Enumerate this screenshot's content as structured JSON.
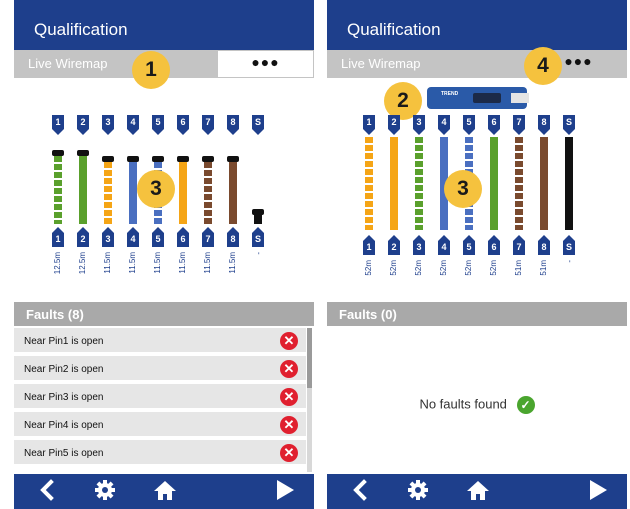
{
  "left": {
    "title": "Qualification",
    "tab_label": "Live Wiremap",
    "more_label": "●●●",
    "callouts": [
      "1",
      "3"
    ],
    "pins": [
      "1",
      "2",
      "3",
      "4",
      "5",
      "6",
      "7",
      "8",
      "S"
    ],
    "lengths": [
      "12.5m",
      "12.5m",
      "11.5m",
      "11.5m",
      "11.5m",
      "11.5m",
      "11.5m",
      "11.5m",
      "-"
    ],
    "faults_header": "Faults (8)",
    "faults": [
      "Near Pin1 is open",
      "Near Pin2 is open",
      "Near Pin3 is open",
      "Near Pin4 is open",
      "Near Pin5 is open"
    ],
    "fault_icon": "error-x-icon"
  },
  "right": {
    "title": "Qualification",
    "tab_label": "Live Wiremap",
    "more_label": "●●●",
    "callouts": [
      "2",
      "3",
      "4"
    ],
    "device_text": "TREND",
    "pins": [
      "1",
      "2",
      "3",
      "4",
      "5",
      "6",
      "7",
      "8",
      "S"
    ],
    "lengths": [
      "52m",
      "52m",
      "52m",
      "52m",
      "52m",
      "52m",
      "51m",
      "51m",
      "-"
    ],
    "faults_header": "Faults (0)",
    "no_faults_text": "No faults found",
    "ok_icon": "check-circle-icon"
  },
  "nav": {
    "back_icon": "chevron-left-icon",
    "settings_icon": "gear-icon",
    "home_icon": "home-icon",
    "run_icon": "play-icon"
  },
  "colors": {
    "brand": "#1e3f8c",
    "callout": "#f5c23e",
    "fault": "#e0202f",
    "ok": "#4aa52e"
  }
}
